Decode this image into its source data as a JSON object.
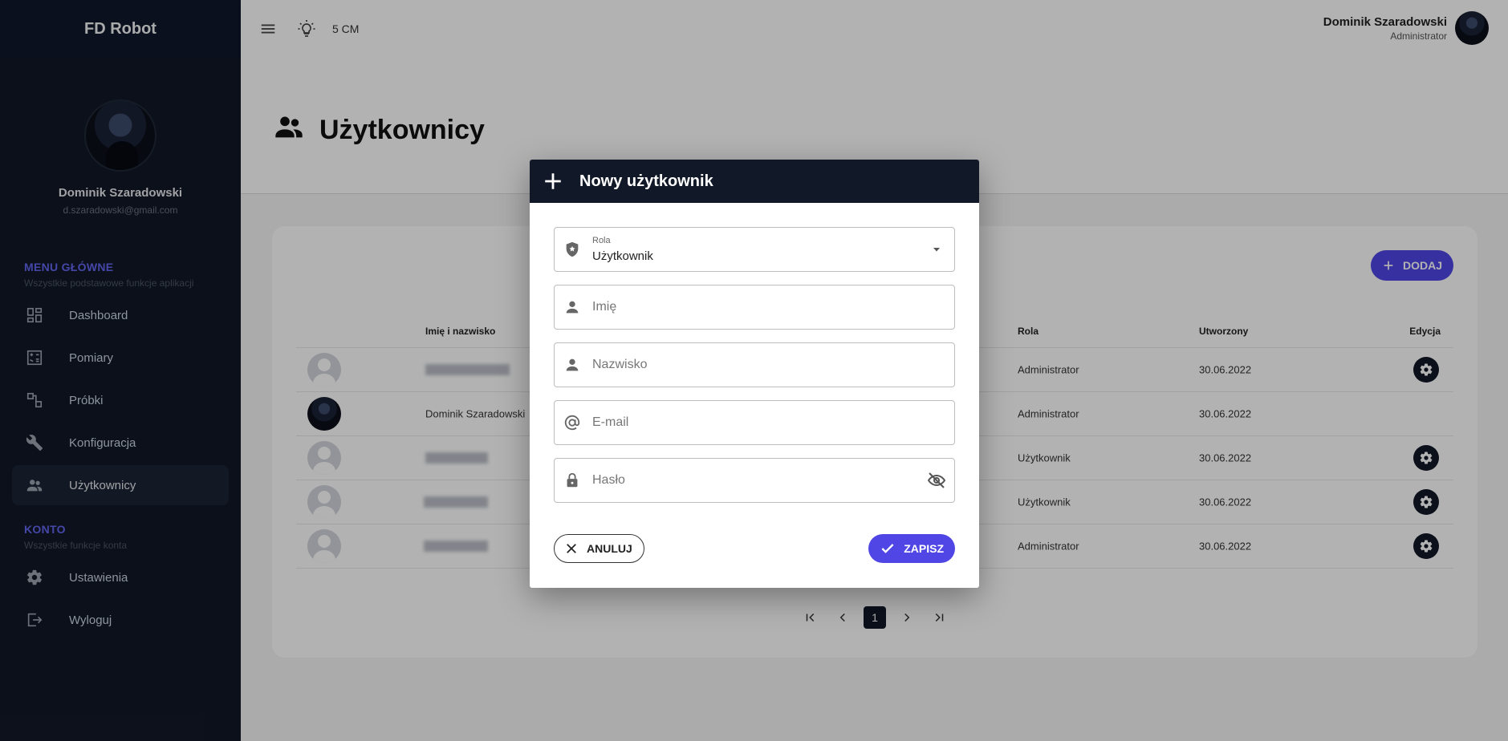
{
  "app": {
    "brand": "FD Robot"
  },
  "sidebar": {
    "profile": {
      "name": "Dominik Szaradowski",
      "email": "d.szaradowski@gmail.com"
    },
    "sections": [
      {
        "title": "MENU GŁÓWNE",
        "subtitle": "Wszystkie podstawowe funkcje aplikacji",
        "items": [
          {
            "label": "Dashboard",
            "icon": "dashboard-icon"
          },
          {
            "label": "Pomiary",
            "icon": "calculator-icon"
          },
          {
            "label": "Próbki",
            "icon": "samples-icon"
          },
          {
            "label": "Konfiguracja",
            "icon": "wrench-icon"
          },
          {
            "label": "Użytkownicy",
            "icon": "users-icon",
            "active": true
          }
        ]
      },
      {
        "title": "KONTO",
        "subtitle": "Wszystkie funkcje konta",
        "items": [
          {
            "label": "Ustawienia",
            "icon": "gear-icon"
          },
          {
            "label": "Wyloguj",
            "icon": "logout-icon"
          }
        ]
      }
    ]
  },
  "topbar": {
    "distance": "5 CM",
    "user_name": "Dominik Szaradowski",
    "user_role": "Administrator"
  },
  "page": {
    "title": "Użytkownicy"
  },
  "users_table": {
    "add_label": "DODAJ",
    "columns": [
      "Imię i nazwisko",
      "Rola",
      "Utworzony",
      "Edycja"
    ],
    "rows": [
      {
        "name": "",
        "role": "Administrator",
        "created": "30.06.2022",
        "editable": true
      },
      {
        "name": "Dominik Szaradowski",
        "role": "Administrator",
        "created": "30.06.2022",
        "editable": false
      },
      {
        "name": "",
        "role": "Użytkownik",
        "created": "30.06.2022",
        "editable": true
      },
      {
        "name": "",
        "role": "Użytkownik",
        "created": "30.06.2022",
        "editable": true
      },
      {
        "name": "",
        "role": "Administrator",
        "created": "30.06.2022",
        "editable": true
      }
    ],
    "pagination": {
      "current_page": "1"
    }
  },
  "modal": {
    "title": "Nowy użytkownik",
    "role_label": "Rola",
    "role_value": "Użytkownik",
    "first_name_placeholder": "Imię",
    "last_name_placeholder": "Nazwisko",
    "email_placeholder": "E-mail",
    "password_placeholder": "Hasło",
    "cancel_label": "ANULUJ",
    "save_label": "ZAPISZ"
  },
  "colors": {
    "sidebar": "#111827",
    "accent": "#4f46e5",
    "section_title": "#6366f1"
  }
}
